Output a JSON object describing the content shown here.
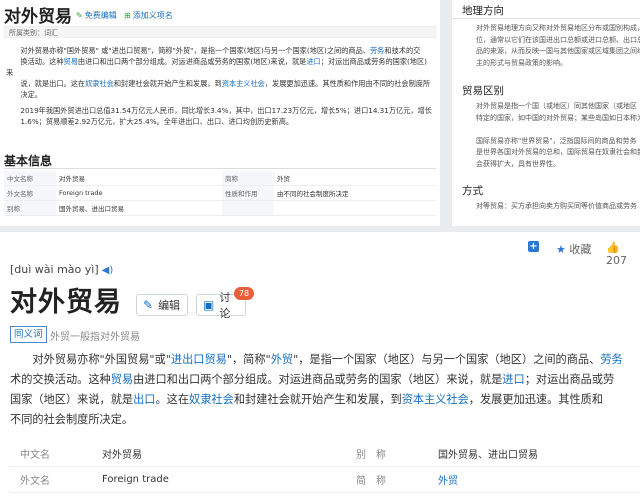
{
  "top_left": {
    "title": "对外贸易",
    "edit_label": "免费编辑",
    "add_synonym_label": "添加义项名",
    "category": "所属类别：词汇",
    "para1_lines": [
      [
        "对外贸易亦称\"国外贸易\" 或\"进出口贸易\"，简称\"外贸\"，是指一个国家(地区)与另一个国家(地区)之间的商品、",
        {
          "link": "劳务"
        },
        "和技术的交"
      ],
      [
        "换活动。这种",
        {
          "link": "贸易"
        },
        "由进口和出口两个部分组成。对运进商品或劳务的国家(地区)来说，就是",
        {
          "link": "进口"
        },
        "；对运出商品或劳务的国家(地区)来"
      ],
      [
        "说，就是出口。这在",
        {
          "link": "奴隶社会"
        },
        "和封建社会就开始产生和发展，到",
        {
          "link": "资本主义社会"
        },
        "，发展更加迅速。其性质和作用由不同的社会制度所"
      ],
      [
        "决定。"
      ]
    ],
    "para2_lines": [
      [
        "2019年我国外贸进出口总值31.54万亿元人民币，同比增长3.4%，其中，出口17.23万亿元，增长5%；进口14.31万亿元，增长"
      ],
      [
        "1.6%；贸易顺差2.92万亿元，扩大25.4%。全年进出口、出口、进口均创历史新高。"
      ]
    ],
    "basic_info_title": "基本信息",
    "basic_info": [
      [
        "中文名称",
        "对外贸易",
        "简称",
        "外贸"
      ],
      [
        "外文名称",
        "Foreign trade",
        "性质和作用",
        "由不同的社会制度所决定"
      ],
      [
        "别称",
        "国外贸易、进出口贸易",
        "",
        ""
      ]
    ]
  },
  "top_right": {
    "h1": "地理方向",
    "p1": [
      "对外贸易地理方向又称对外贸易地区分布或国别构成，",
      "位，通常以它们在该国进出口总额或进口总额、出口总",
      "品的来源，从而反映一国与其他国家或区域集团之间经",
      "主的形式与贸易政策的影响。"
    ],
    "h2": "贸易区别",
    "p2": [
      "对外贸易是指一个国（或地区）同其他国家（或地区",
      "特定的国家，如中国的对外贸易；某些岛国如日本称为",
      "",
      "国际贸易亦称\"世界贸易\"，泛指国际间的商品和劳务",
      "是世界各国对外贸易的总和，国际贸易在奴隶社会和封",
      "会获得扩大，具有世界性。"
    ],
    "h3": "方式",
    "p3": [
      "对等贸易：买方承担向卖方购买同等价值商品或劳务"
    ]
  },
  "bottom": {
    "add_label": "+",
    "collect_label": "收藏",
    "like_count": "207",
    "pinyin": "[duì wài mào yì]",
    "title": "对外贸易",
    "edit_label": "编辑",
    "discuss_label": "讨论",
    "discuss_count": "78",
    "synonym_tag": "同义词",
    "synonym_text": "外贸一般指对外贸易",
    "para_lines": [
      [
        "　　对外贸易亦称\"外国贸易\"或\"",
        {
          "link": "进出口贸易"
        },
        "\"，简称\"",
        {
          "link": "外贸"
        },
        "\"，是指一个国家（地区）与另一个国家（地区）之间的商品、",
        {
          "link": "劳务"
        }
      ],
      [
        "术的交换活动。这种",
        {
          "link": "贸易"
        },
        "由进口和出口两个部分组成。对运进商品或劳务的国家（地区）来说，就是",
        {
          "link": "进口"
        },
        "；对运出商品或劳"
      ],
      [
        "国家（地区）来说，就是",
        {
          "link": "出口"
        },
        "。这在",
        {
          "link": "奴隶社会"
        },
        "和封建社会就开始产生和发展，到",
        {
          "link": "资本主义社会"
        },
        "，发展更加迅速。其性质和"
      ],
      [
        "不同的社会制度所决定。"
      ]
    ],
    "info_rows": [
      [
        "中文名",
        "对外贸易",
        "别　称",
        "国外贸易、进出口贸易"
      ],
      [
        "外文名",
        "Foreign trade",
        "简　称",
        "外贸"
      ]
    ]
  },
  "colors": {
    "link": "#136ec2",
    "badge": "#e85f3a",
    "edit_icon": "#3a9a3a"
  },
  "icons": [
    "pencil-icon",
    "plus-icon",
    "star-icon",
    "thumbs-up-icon",
    "speaker-icon",
    "chat-icon"
  ]
}
